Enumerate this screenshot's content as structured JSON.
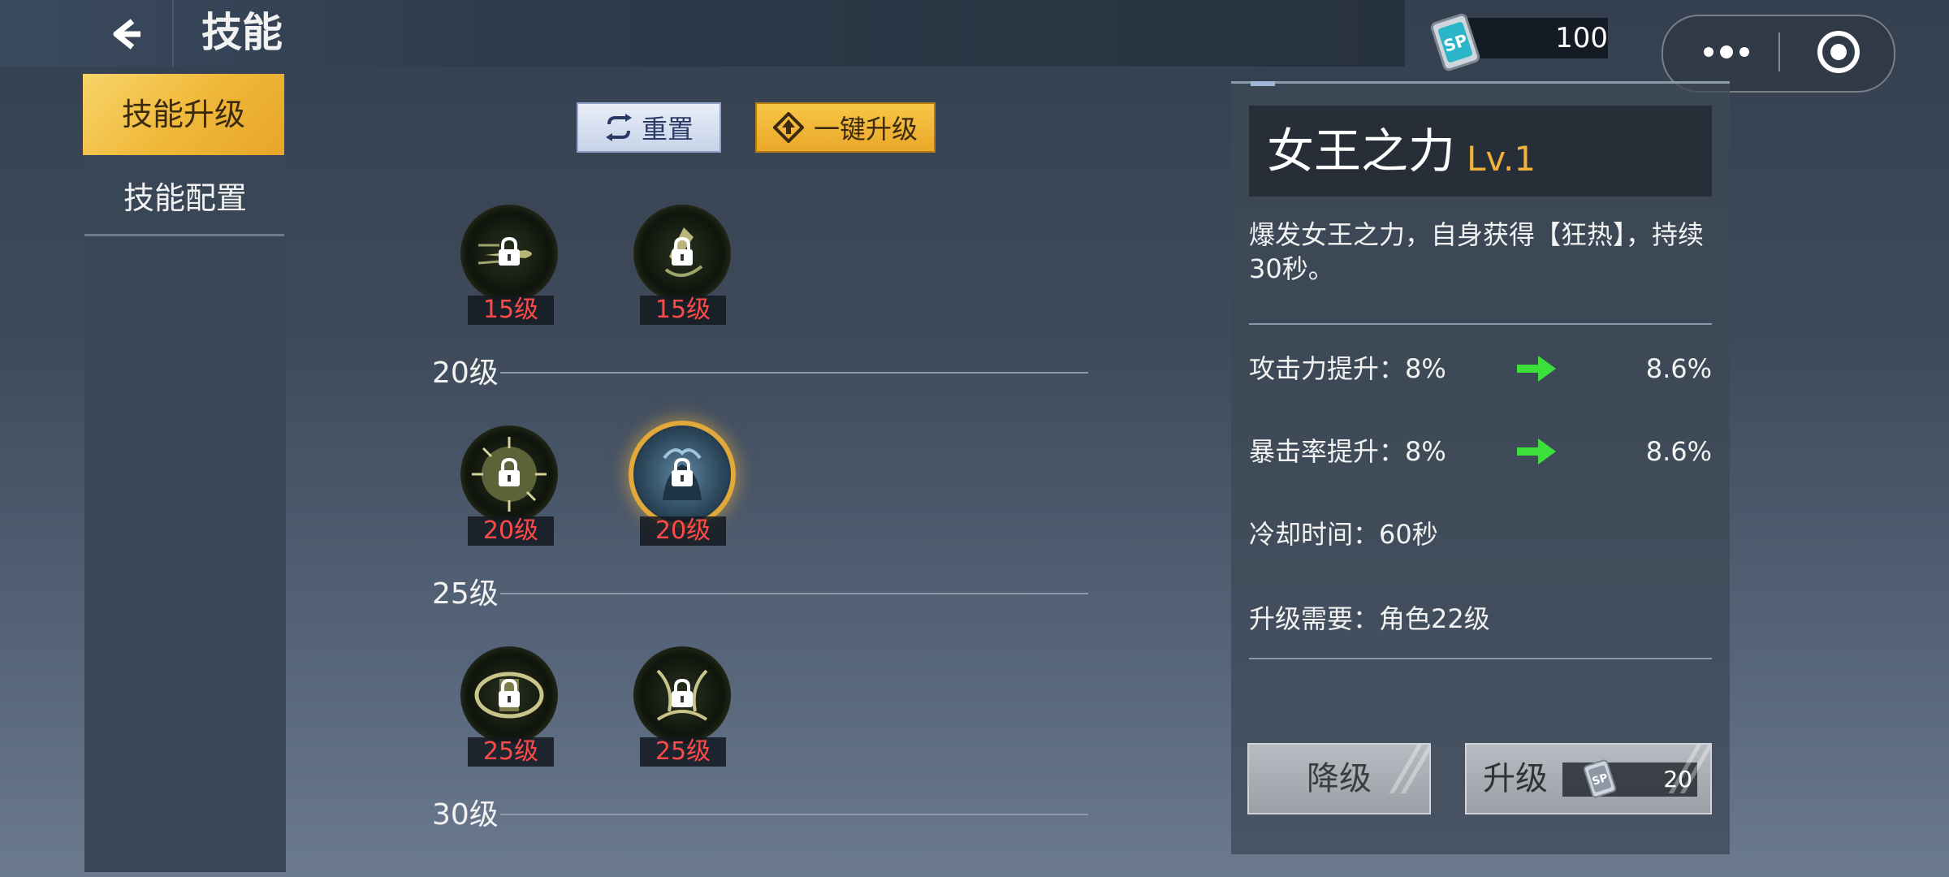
{
  "header": {
    "title": "技能"
  },
  "currency": {
    "icon": "sp-card-icon",
    "icon_text": "SP",
    "amount": "100"
  },
  "sidebar": {
    "tabs": [
      {
        "label": "技能升级",
        "active": true
      },
      {
        "label": "技能配置",
        "active": false
      }
    ]
  },
  "toolbar": {
    "reset_label": "重置",
    "one_click_label": "一键升级"
  },
  "skill_tree": {
    "rows": [
      {
        "skills": [
          {
            "level_req": "15级",
            "icon": "bullet-skill-icon"
          },
          {
            "level_req": "15级",
            "icon": "dagger-skill-icon"
          }
        ]
      },
      {
        "tier_label": "20级",
        "skills": [
          {
            "level_req": "20级",
            "icon": "burst-skill-icon"
          },
          {
            "level_req": "20级",
            "icon": "queen-power-skill-icon",
            "selected": true
          }
        ]
      },
      {
        "tier_label": "25级",
        "skills": [
          {
            "level_req": "25级",
            "icon": "shield-skill-icon"
          },
          {
            "level_req": "25级",
            "icon": "claw-skill-icon"
          }
        ]
      },
      {
        "tier_label": "30级"
      }
    ]
  },
  "detail": {
    "name": "女王之力",
    "level": "Lv.1",
    "description": "爆发女王之力，自身获得【狂热】，持续30秒。",
    "stats": [
      {
        "label": "攻击力提升：8%",
        "next": "8.6%"
      },
      {
        "label": "暴击率提升：8%",
        "next": "8.6%"
      },
      {
        "label": "冷却时间：60秒"
      },
      {
        "label": "升级需要：角色22级"
      }
    ],
    "downgrade_label": "降级",
    "upgrade_label": "升级",
    "upgrade_cost": "20",
    "accent_color": "#f0b23a",
    "arrow_color": "#3be03b",
    "level_req_color": "#ff4a4a"
  }
}
